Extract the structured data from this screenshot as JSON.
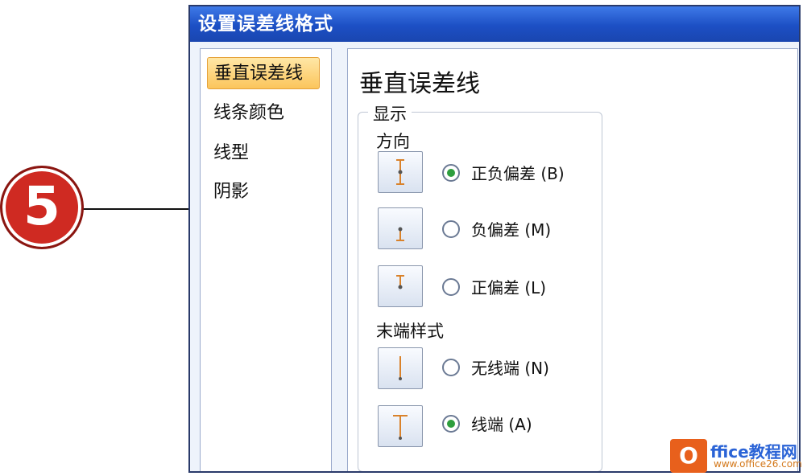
{
  "dialog": {
    "title": "设置误差线格式"
  },
  "nav": {
    "items": [
      {
        "label": "垂直误差线",
        "active": true
      },
      {
        "label": "线条颜色",
        "active": false
      },
      {
        "label": "线型",
        "active": false
      },
      {
        "label": "阴影",
        "active": false
      }
    ]
  },
  "panel": {
    "title": "垂直误差线",
    "group_label": "显示",
    "direction": {
      "label": "方向",
      "options": [
        {
          "label": "正负偏差 (B)",
          "selected": true,
          "icon": "both-direction-icon"
        },
        {
          "label": "负偏差 (M)",
          "selected": false,
          "icon": "minus-direction-icon"
        },
        {
          "label": "正偏差 (L)",
          "selected": false,
          "icon": "plus-direction-icon"
        }
      ]
    },
    "end_style": {
      "label": "末端样式",
      "options": [
        {
          "label": "无线端 (N)",
          "selected": false,
          "icon": "no-cap-icon"
        },
        {
          "label": "线端 (A)",
          "selected": true,
          "icon": "cap-icon"
        }
      ]
    }
  },
  "callout": {
    "number": "5"
  },
  "watermark": {
    "logo": "O",
    "title": "ffice教程网",
    "url": "www.office26.com"
  },
  "colors": {
    "titlebar": "#1c4fc4",
    "radio_selected": "#2e9e3e",
    "icon_accent": "#d9822b",
    "callout": "#cf2a22"
  }
}
